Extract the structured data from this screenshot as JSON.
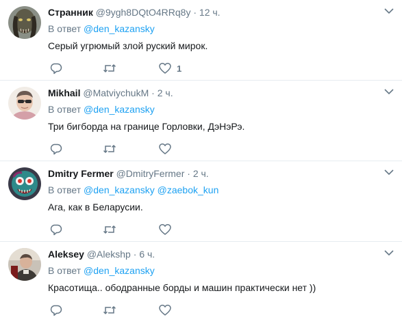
{
  "tweets": [
    {
      "name": "Странник",
      "handle": "@9ygh8DQtO4RRq8y",
      "dot": "·",
      "time": "12 ч.",
      "reply_prefix": "В ответ",
      "mentions": [
        "@den_kazansky"
      ],
      "text": "Серый угрюмый злой руский мирок.",
      "like_count": "1",
      "avatar_icon": "predator-avatar"
    },
    {
      "name": "Mikhail",
      "handle": "@MatviychukM",
      "dot": "·",
      "time": "2 ч.",
      "reply_prefix": "В ответ",
      "mentions": [
        "@den_kazansky"
      ],
      "text": "Три бигборда на границе Горловки, ДэНэРэ.",
      "like_count": "",
      "avatar_icon": "person-with-sunglasses-avatar"
    },
    {
      "name": "Dmitry Fermer",
      "handle": "@DmitryFermer",
      "dot": "·",
      "time": "2 ч.",
      "reply_prefix": "В ответ",
      "mentions": [
        "@den_kazansky",
        "@zaebok_kun"
      ],
      "text": "Ага, как в Беларусии.",
      "like_count": "",
      "avatar_icon": "zombie-avatar"
    },
    {
      "name": "Aleksey",
      "handle": "@Alekshp",
      "dot": "·",
      "time": "6 ч.",
      "reply_prefix": "В ответ",
      "mentions": [
        "@den_kazansky"
      ],
      "text": "Красотища.. ободранные борды и машин практически нет ))",
      "like_count": "",
      "avatar_icon": "photo-avatar"
    }
  ],
  "colors": {
    "link": "#1da1f2",
    "secondary": "#657786",
    "text": "#14171a",
    "border": "#e6ecf0"
  }
}
